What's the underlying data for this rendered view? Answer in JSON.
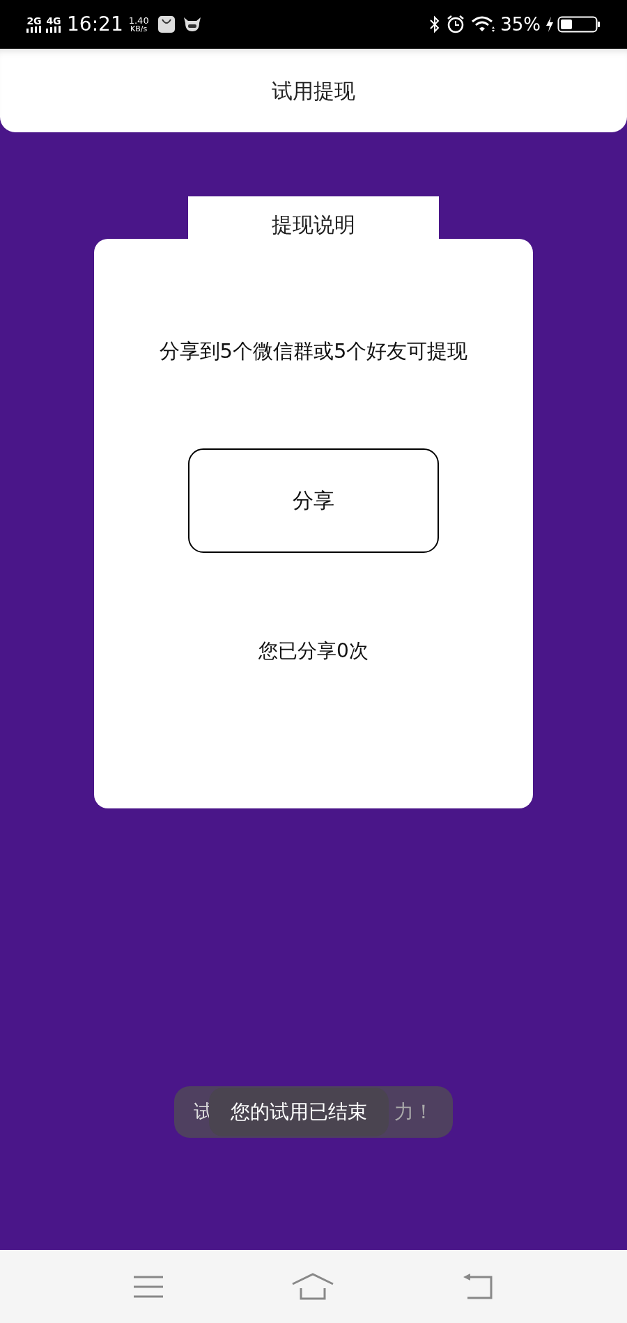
{
  "status_bar": {
    "network_1": "2G",
    "network_2": "4G",
    "time": "16:21",
    "speed_value": "1.40",
    "speed_unit": "KB/s",
    "battery_percent": "35%"
  },
  "header": {
    "title": "试用提现"
  },
  "card": {
    "tab_title": "提现说明",
    "description": "分享到5个微信群或5个好友可提现",
    "share_button": "分享",
    "share_count": "您已分享0次"
  },
  "toasts": [
    {
      "text_start": "试",
      "text_end": "力！"
    },
    {
      "text": "您的试用已结束"
    }
  ]
}
